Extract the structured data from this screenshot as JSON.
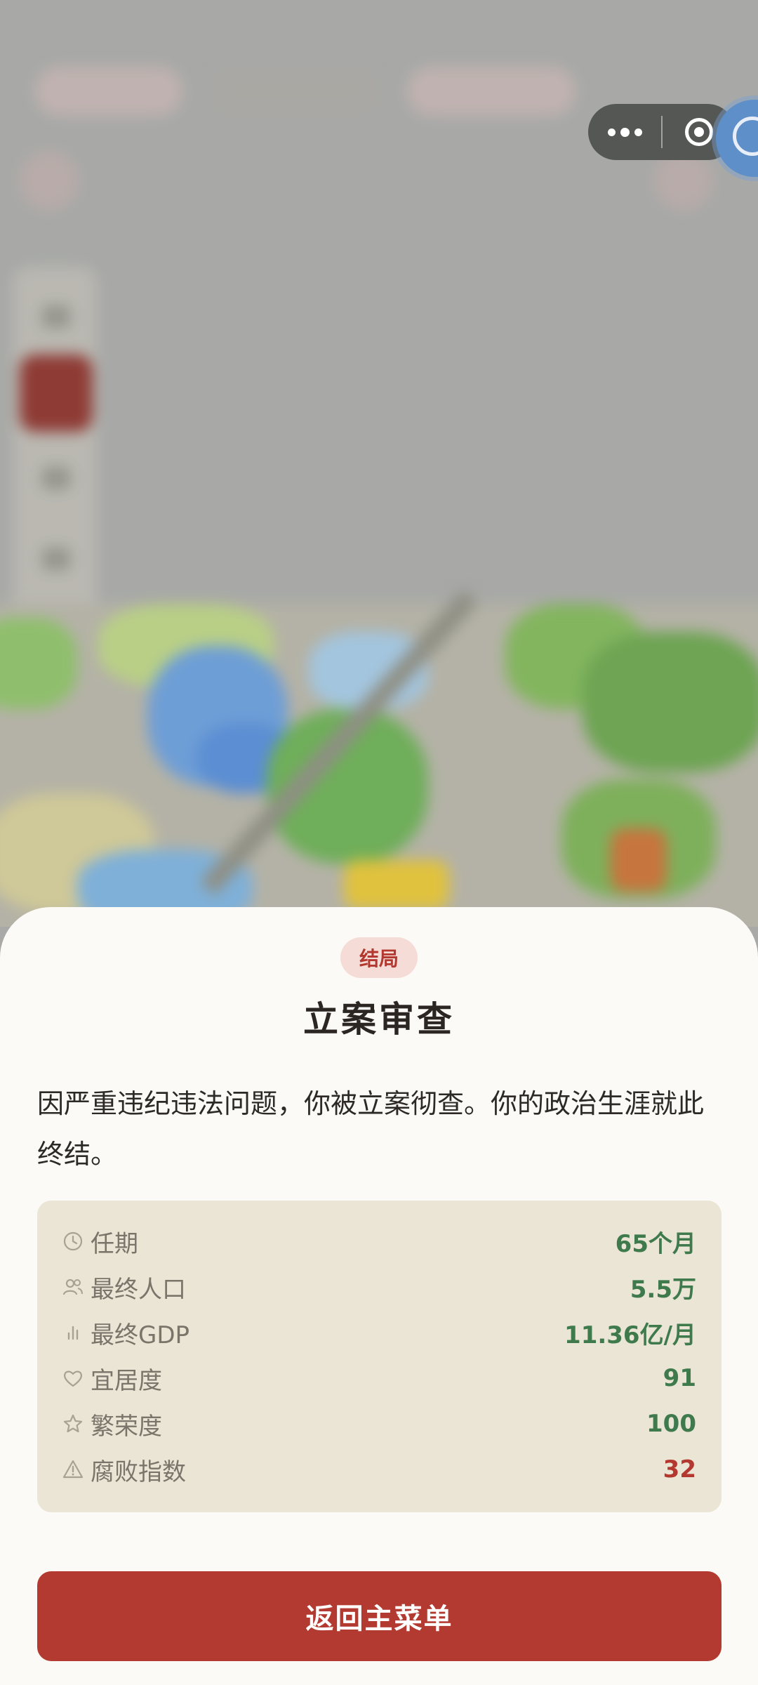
{
  "ending": {
    "tag": "结局",
    "title": "立案审查",
    "description": "因严重违纪违法问题，你被立案彻查。你的政治生涯就此终结。"
  },
  "stats": [
    {
      "icon": "clock-icon",
      "label": "任期",
      "value": "65个月",
      "color": "#3f7a4d"
    },
    {
      "icon": "people-icon",
      "label": "最终人口",
      "value": "5.5万",
      "color": "#3f7a4d"
    },
    {
      "icon": "bar-chart-icon",
      "label": "最终GDP",
      "value": "11.36亿/月",
      "color": "#3f7a4d"
    },
    {
      "icon": "heart-icon",
      "label": "宜居度",
      "value": "91",
      "color": "#3f7a4d"
    },
    {
      "icon": "star-icon",
      "label": "繁荣度",
      "value": "100",
      "color": "#3f7a4d"
    },
    {
      "icon": "warning-icon",
      "label": "腐败指数",
      "value": "32",
      "color": "#b3382f"
    }
  ],
  "actions": {
    "return_menu": "返回主菜单"
  },
  "capsule": {
    "more_icon": "more-dots-icon",
    "close_icon": "target-close-icon"
  },
  "colors": {
    "accent": "#b23a30",
    "positive": "#3f7a4d",
    "negative": "#b3382f",
    "sheet": "#fcfaf6",
    "stats_panel": "#ebe5d5"
  }
}
